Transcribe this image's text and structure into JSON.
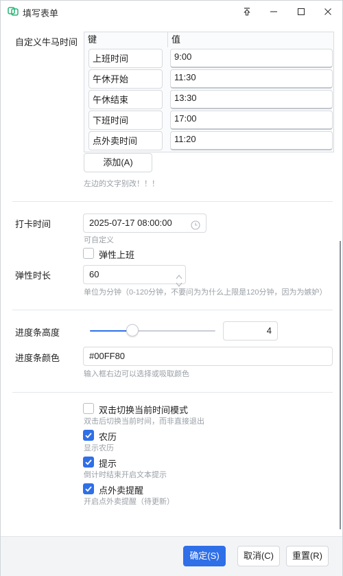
{
  "window": {
    "title": "填写表单"
  },
  "custom_time": {
    "label": "自定义牛马时间",
    "col_key": "键",
    "col_value": "值",
    "rows": [
      {
        "key": "上班时间",
        "value": "9:00"
      },
      {
        "key": "午休开始",
        "value": "11:30"
      },
      {
        "key": "午休结束",
        "value": "13:30"
      },
      {
        "key": "下班时间",
        "value": "17:00"
      },
      {
        "key": "点外卖时间",
        "value": "11:20"
      }
    ],
    "add_button": "添加(A)",
    "hint": "左边的文字别改！！！"
  },
  "punch": {
    "label": "打卡时间",
    "value": "2025-07-17 08:00:00",
    "hint": "可自定义",
    "flex_checkbox": {
      "label": "弹性上班",
      "checked": false
    }
  },
  "flex_duration": {
    "label": "弹性时长",
    "value": "60",
    "hint": "单位为分钟（0-120分钟，不要问为为什么上限是120分钟，因为为嫉妒）"
  },
  "progress": {
    "height_label": "进度条高度",
    "height_value": "4",
    "slider_fraction": 0.34,
    "color_label": "进度条颜色",
    "color_value": "#00FF80",
    "color_hint": "输入框右边可以选择或吸取颜色"
  },
  "options": [
    {
      "label": "双击切换当前时间模式",
      "hint": "双击后切换当前时间，而非直接退出",
      "checked": false
    },
    {
      "label": "农历",
      "hint": "显示农历",
      "checked": true
    },
    {
      "label": "提示",
      "hint": "倒计时结束开启文本提示",
      "checked": true
    },
    {
      "label": "点外卖提醒",
      "hint": "开启点外卖提醒（待更新）",
      "checked": true
    }
  ],
  "footer": {
    "confirm": "确定(S)",
    "cancel": "取消(C)",
    "reset": "重置(R)"
  },
  "colors": {
    "accent": "#2f6fe8",
    "hint": "#9aa0a6"
  }
}
